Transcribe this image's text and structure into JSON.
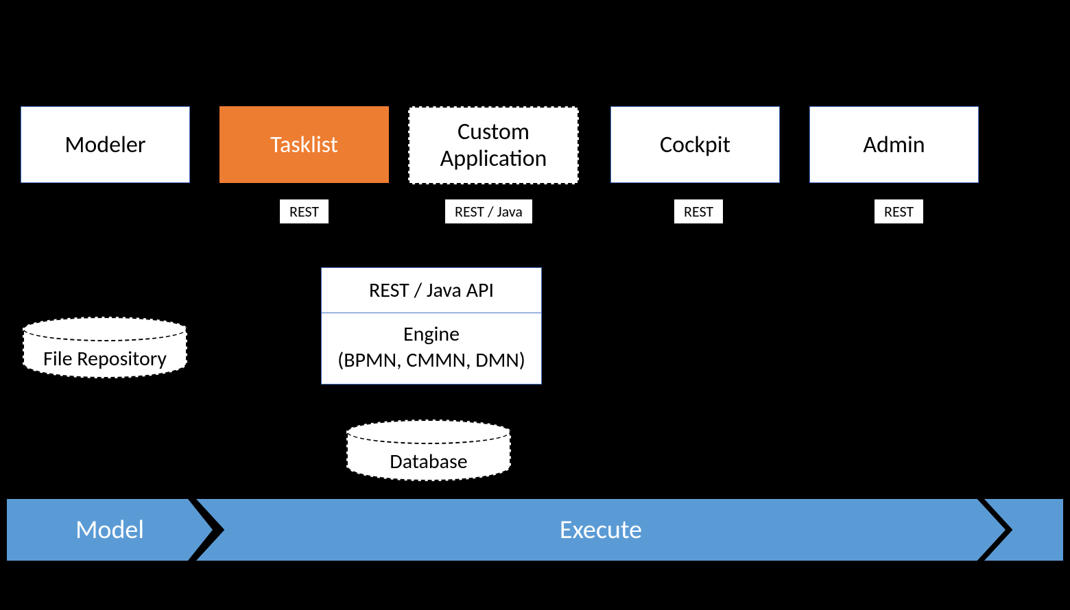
{
  "boxes": {
    "modeler": "Modeler",
    "tasklist": "Tasklist",
    "custom_app": "Custom\nApplication",
    "cockpit": "Cockpit",
    "admin": "Admin"
  },
  "tags": {
    "tasklist": "REST",
    "custom_app": "REST / Java",
    "cockpit": "REST",
    "admin": "REST"
  },
  "engine": {
    "api": "REST / Java API",
    "title": "Engine",
    "subtitle": "(BPMN, CMMN, DMN)"
  },
  "cylinders": {
    "file_repo": "File Repository",
    "database": "Database"
  },
  "phases": {
    "model": "Model",
    "execute": "Execute"
  }
}
